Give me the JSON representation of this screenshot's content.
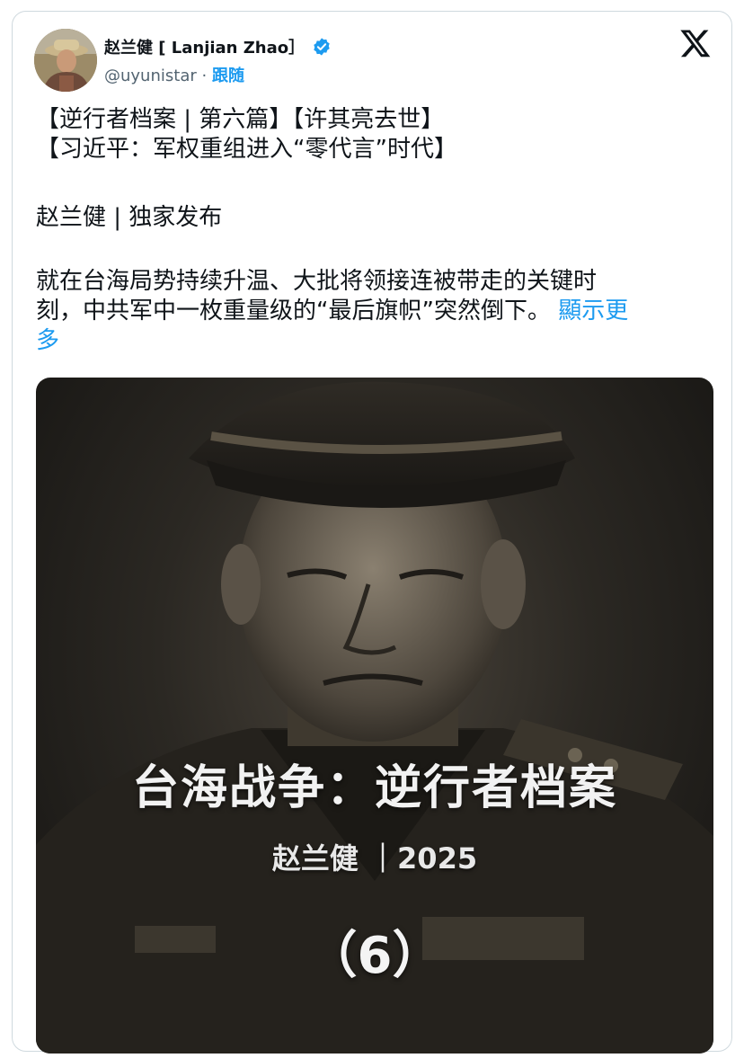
{
  "tweet": {
    "author_name": "赵兰健 [ Lanjian Zhao］",
    "handle": "@uyunistar",
    "separator": "·",
    "follow_label": "跟随",
    "lines": [
      "【逆行者档案 | 第六篇】【许其亮去世】",
      "【习近平：军权重组进入“零代言”时代】",
      "赵兰健 | 独家发布",
      "就在台海局势持续升温、大批将领接连被带走的关键时",
      "刻，中共军中一枚重量级的“最后旗帜”突然倒下。"
    ],
    "show_more": "顯示更",
    "show_more_2": "多"
  },
  "image": {
    "title": "台海战争：逆行者档案",
    "author_line": "赵兰健 ｜2025",
    "number": "（6）"
  },
  "colors": {
    "accent": "#1d9bf0",
    "text": "#0f1419",
    "secondary": "#536471"
  },
  "icons": {
    "verified": "verified-badge-icon",
    "logo": "x-logo-icon"
  }
}
